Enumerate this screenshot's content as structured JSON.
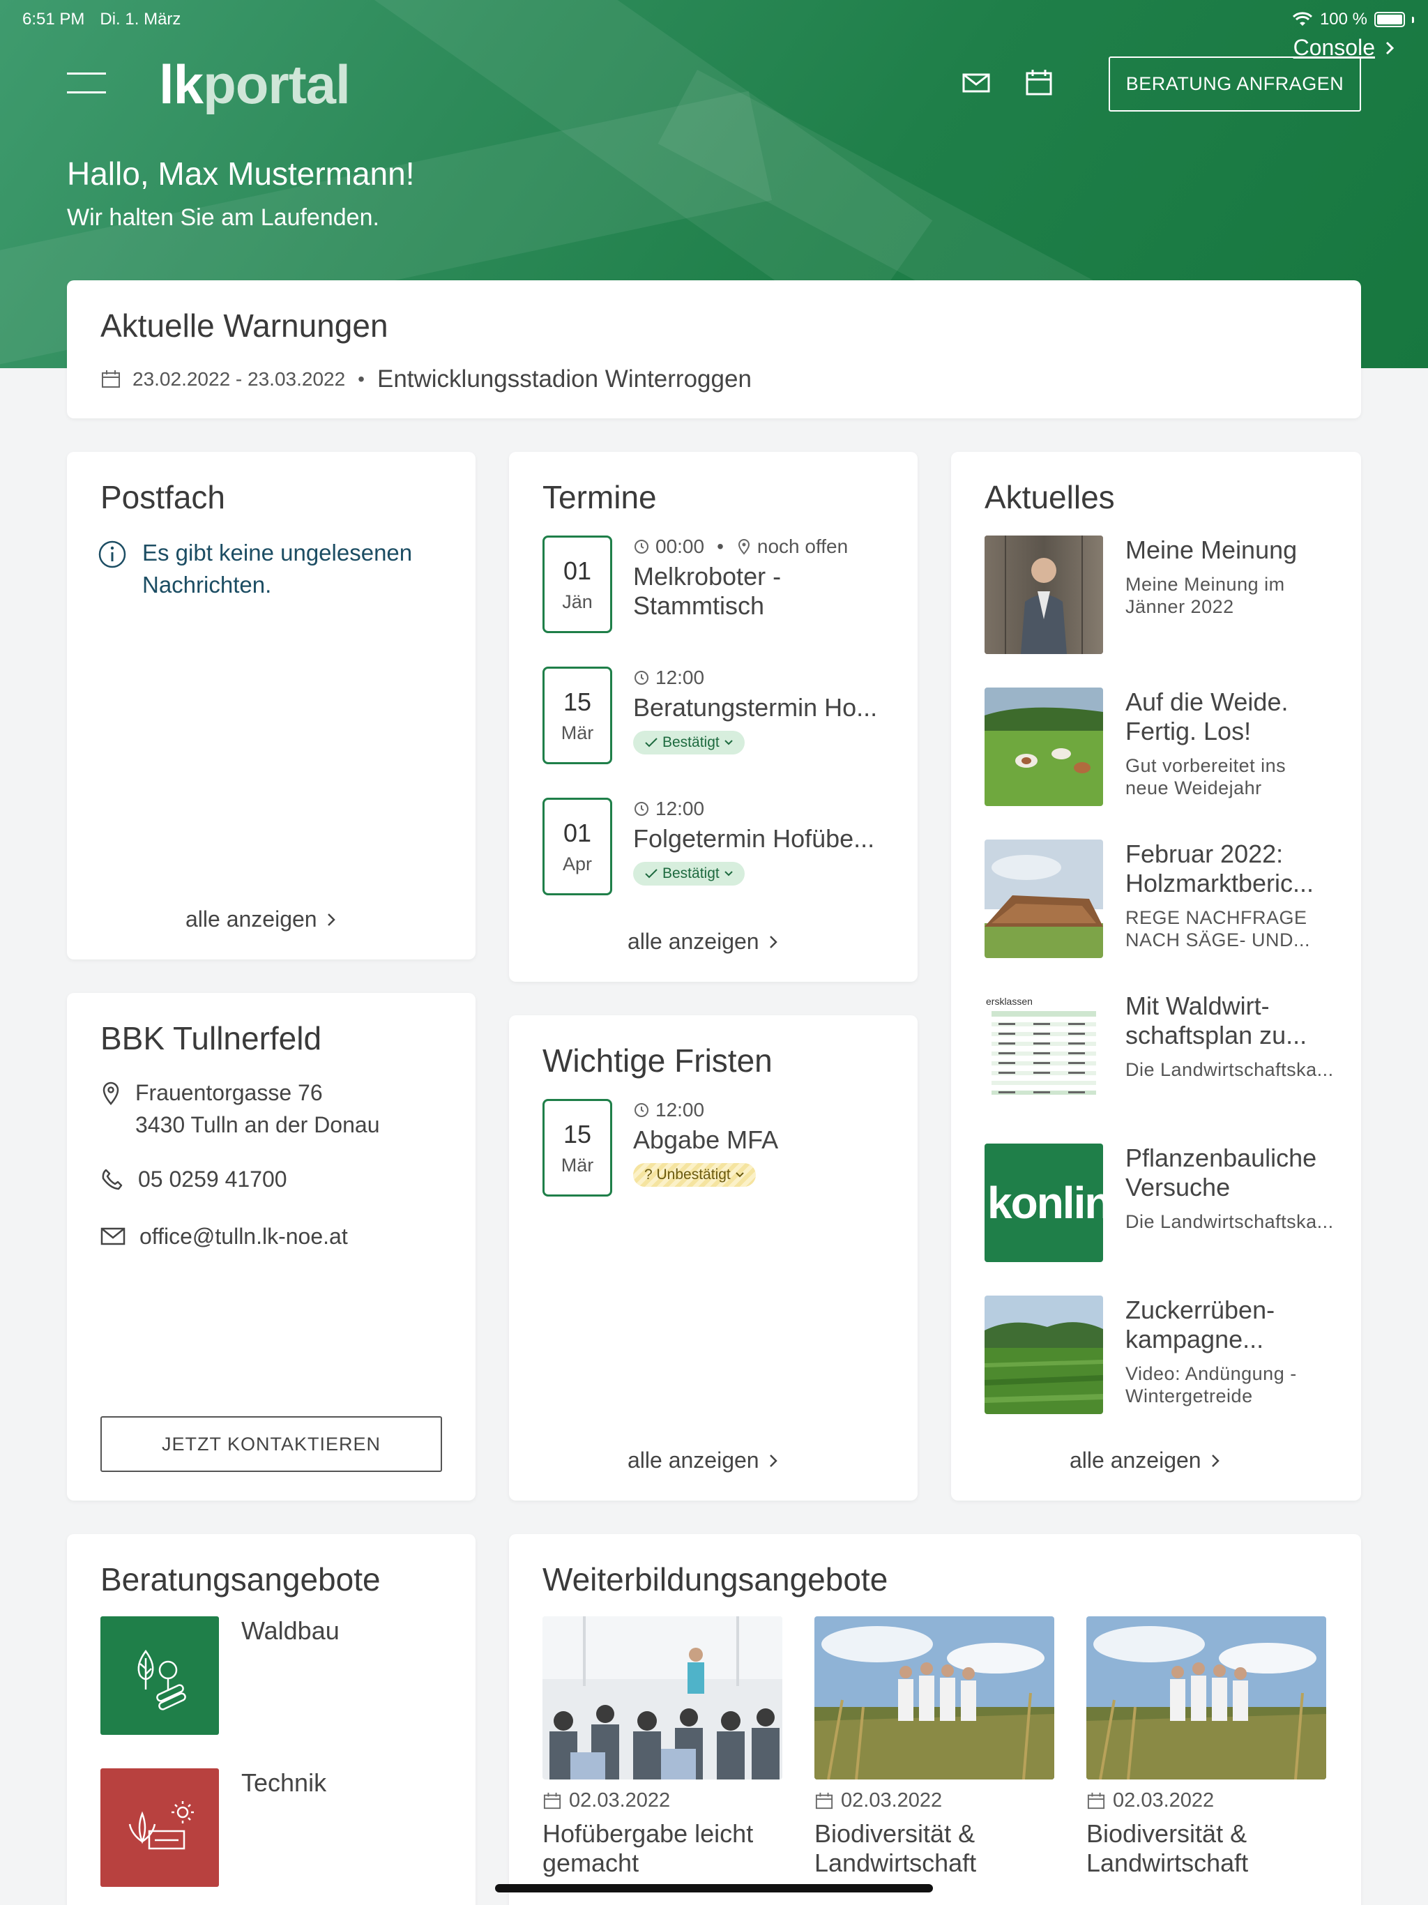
{
  "status_bar": {
    "time": "6:51 PM",
    "date": "Di. 1. März",
    "battery": "100 %"
  },
  "header": {
    "console_link": "Console",
    "logo_lk": "lk",
    "logo_portal": "portal",
    "cta_button": "BERATUNG ANFRAGEN",
    "greeting": "Hallo, Max Mustermann!",
    "subgreeting": "Wir halten Sie am Laufenden."
  },
  "warnings": {
    "title": "Aktuelle Warnungen",
    "date_range": "23.02.2022 - 23.03.2022",
    "separator": "•",
    "topic": "Entwicklungsstadion Winterroggen"
  },
  "postfach": {
    "title": "Postfach",
    "info": "Es gibt keine ungelesenen Nachrichten.",
    "more": "alle anzeigen"
  },
  "termine": {
    "title": "Termine",
    "items": [
      {
        "day": "01",
        "month": "Jän",
        "time": "00:00",
        "dot": "•",
        "location": "noch offen",
        "title": "Melkroboter - Stammtisch"
      },
      {
        "day": "15",
        "month": "Mär",
        "time": "12:00",
        "title": "Beratungstermin Ho...",
        "status": "Bestätigt"
      },
      {
        "day": "01",
        "month": "Apr",
        "time": "12:00",
        "title": "Folgetermin Hofübe...",
        "status": "Bestätigt"
      }
    ],
    "more": "alle anzeigen"
  },
  "aktuelles": {
    "title": "Aktuelles",
    "items": [
      {
        "title": "Meine Meinung",
        "subtitle": "Meine Meinung im Jänner 2022"
      },
      {
        "title": "Auf die Weide. Fertig. Los!",
        "subtitle": "Gut vorbereitet ins neue Weidejahr"
      },
      {
        "title": "Februar 2022: Holzmarktberic...",
        "subtitle": "REGE NACHFRAGE NACH SÄGE- UND..."
      },
      {
        "title": "Mit Waldwirt-schaftsplan zu...",
        "subtitle": "Die Landwirtschaftska..."
      },
      {
        "title": "Pflanzenbauliche Versuche",
        "subtitle": "Die Landwirtschaftska..."
      },
      {
        "title": "Zuckerrüben-kampagne...",
        "subtitle": "Video: Andüngung - Wintergetreide"
      }
    ],
    "thumb_konline": "konline",
    "thumb_table_header": "ersklassen",
    "more": "alle anzeigen"
  },
  "bbk": {
    "title": "BBK Tullnerfeld",
    "street": "Frauentorgasse 76",
    "city": "3430 Tulln an der Donau",
    "phone": "05 0259 41700",
    "email": "office@tulln.lk-noe.at",
    "button": "JETZT KONTAKTIEREN"
  },
  "fristen": {
    "title": "Wichtige Fristen",
    "items": [
      {
        "day": "15",
        "month": "Mär",
        "time": "12:00",
        "title": "Abgabe MFA",
        "status": "? Unbestätigt"
      }
    ],
    "more": "alle anzeigen"
  },
  "beratung": {
    "title": "Beratungsangebote",
    "items": [
      {
        "label": "Waldbau",
        "color": "#1f7f49"
      },
      {
        "label": "Technik",
        "color": "#b8413f"
      }
    ]
  },
  "weiterbildung": {
    "title": "Weiterbildungsangebote",
    "items": [
      {
        "date": "02.03.2022",
        "title": "Hofübergabe leicht gemacht"
      },
      {
        "date": "02.03.2022",
        "title": "Biodiversität & Landwirtschaft"
      },
      {
        "date": "02.03.2022",
        "title": "Biodiversität & Landwirtschaft"
      }
    ]
  },
  "colors": {
    "brand_green": "#1f7f49",
    "technik_red": "#b8413f",
    "confirmed_bg": "#d7eedd"
  }
}
